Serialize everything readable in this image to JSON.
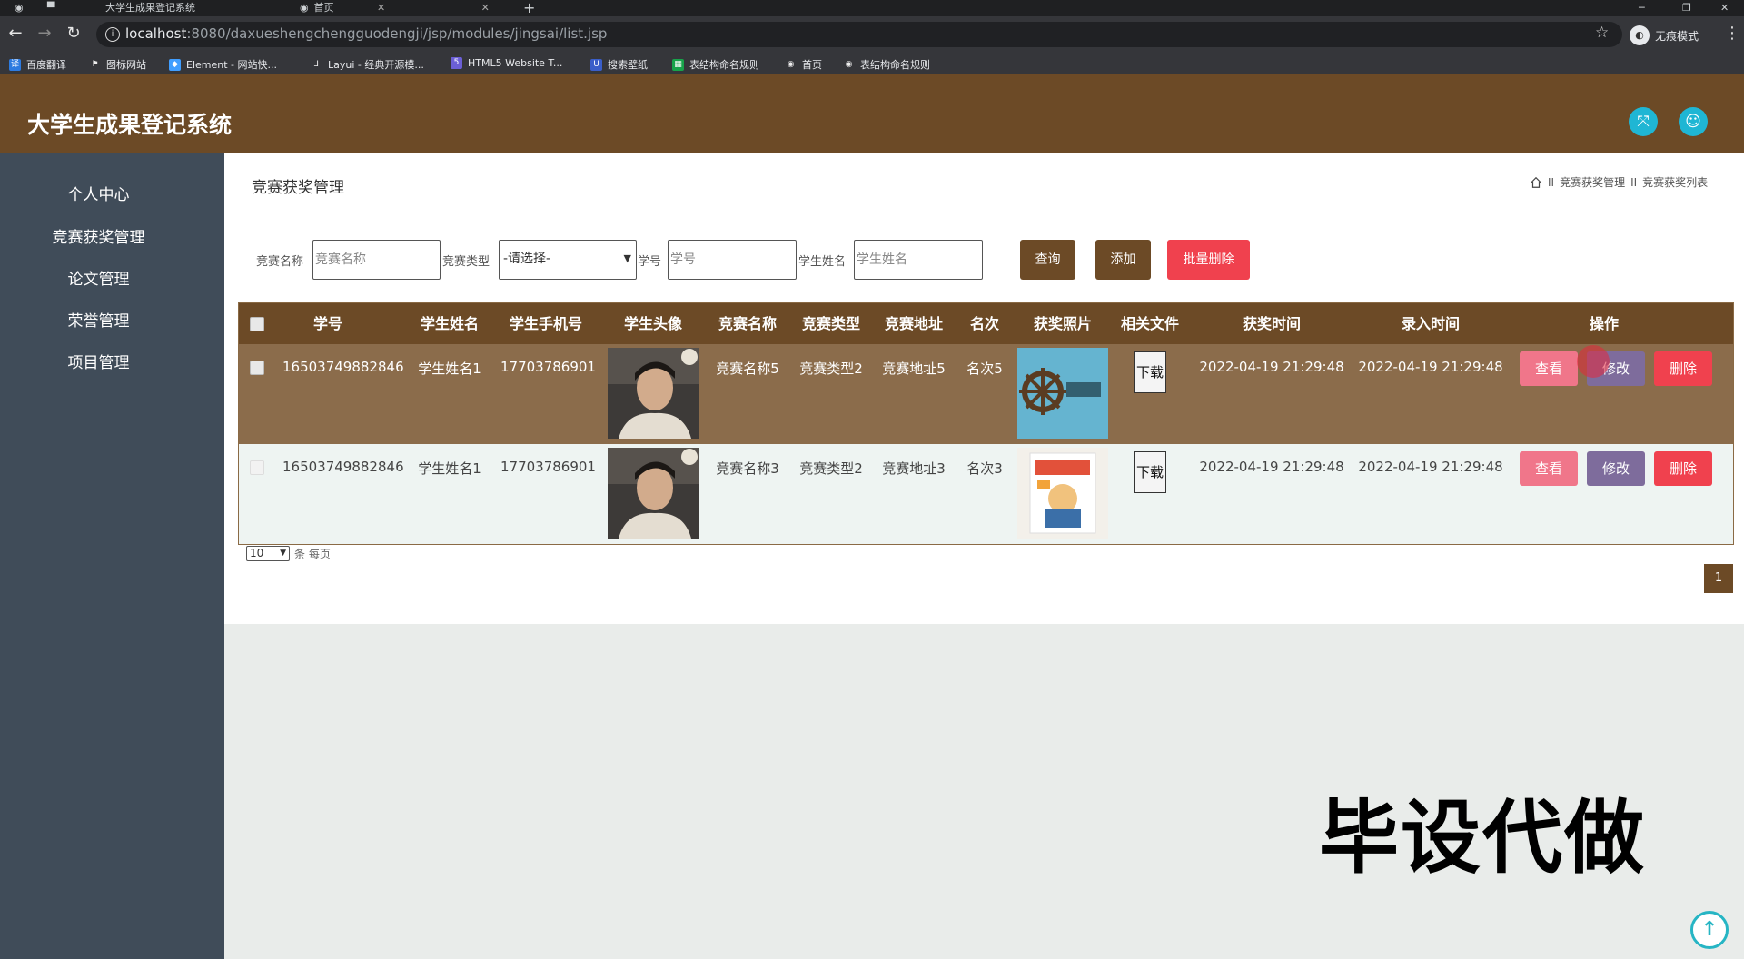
{
  "browser": {
    "tabs": [
      {
        "title": "大学生成果登记系统"
      },
      {
        "title": "首页"
      }
    ],
    "url_host": "localhost",
    "url_path": ":8080/daxueshengchengguodengji/jsp/modules/jingsai/list.jsp",
    "incognito_label": "无痕模式",
    "bookmarks": [
      "百度翻译",
      "图标网站",
      "Element - 网站快...",
      "Layui - 经典开源模...",
      "HTML5 Website T...",
      "搜索壁纸",
      "表结构命名规则",
      "首页",
      "表结构命名规则"
    ]
  },
  "app": {
    "title": "大学生成果登记系统"
  },
  "sidebar": {
    "items": [
      "个人中心",
      "竞赛获奖管理",
      "论文管理",
      "荣誉管理",
      "项目管理"
    ]
  },
  "page": {
    "title": "竞赛获奖管理",
    "breadcrumb": [
      "竞赛获奖管理",
      "竞赛获奖列表"
    ],
    "breadcrumb_sep": "II"
  },
  "filters": {
    "name_label": "竞赛名称",
    "name_placeholder": "竞赛名称",
    "type_label": "竞赛类型",
    "type_value": "-请选择-",
    "id_label": "学号",
    "id_placeholder": "学号",
    "student_label": "学生姓名",
    "student_placeholder": "学生姓名",
    "query_btn": "查询",
    "add_btn": "添加",
    "batch_delete_btn": "批量删除"
  },
  "table": {
    "headers": [
      "学号",
      "学生姓名",
      "学生手机号",
      "学生头像",
      "竞赛名称",
      "竞赛类型",
      "竞赛地址",
      "名次",
      "获奖照片",
      "相关文件",
      "获奖时间",
      "录入时间",
      "操作"
    ],
    "rows": [
      {
        "student_id": "16503749882846",
        "name": "学生姓名1",
        "phone": "17703786901",
        "contest": "竞赛名称5",
        "type": "竞赛类型2",
        "address": "竞赛地址5",
        "rank": "名次5",
        "file_btn": "下载",
        "award_time": "2022-04-19 21:29:48",
        "entry_time": "2022-04-19 21:29:48"
      },
      {
        "student_id": "16503749882846",
        "name": "学生姓名1",
        "phone": "17703786901",
        "contest": "竞赛名称3",
        "type": "竞赛类型2",
        "address": "竞赛地址3",
        "rank": "名次3",
        "file_btn": "下载",
        "award_time": "2022-04-19 21:29:48",
        "entry_time": "2022-04-19 21:29:48"
      }
    ],
    "actions": {
      "view": "查看",
      "edit": "修改",
      "delete": "删除"
    }
  },
  "pagination": {
    "per_page": "10",
    "per_page_suffix": "条 每页",
    "current_page": "1"
  },
  "watermark": "毕设代做",
  "colors": {
    "header_brown": "#6c4a26",
    "sidebar": "#404c59",
    "accent_cyan": "#1fb6d4",
    "danger": "#f0414e"
  }
}
